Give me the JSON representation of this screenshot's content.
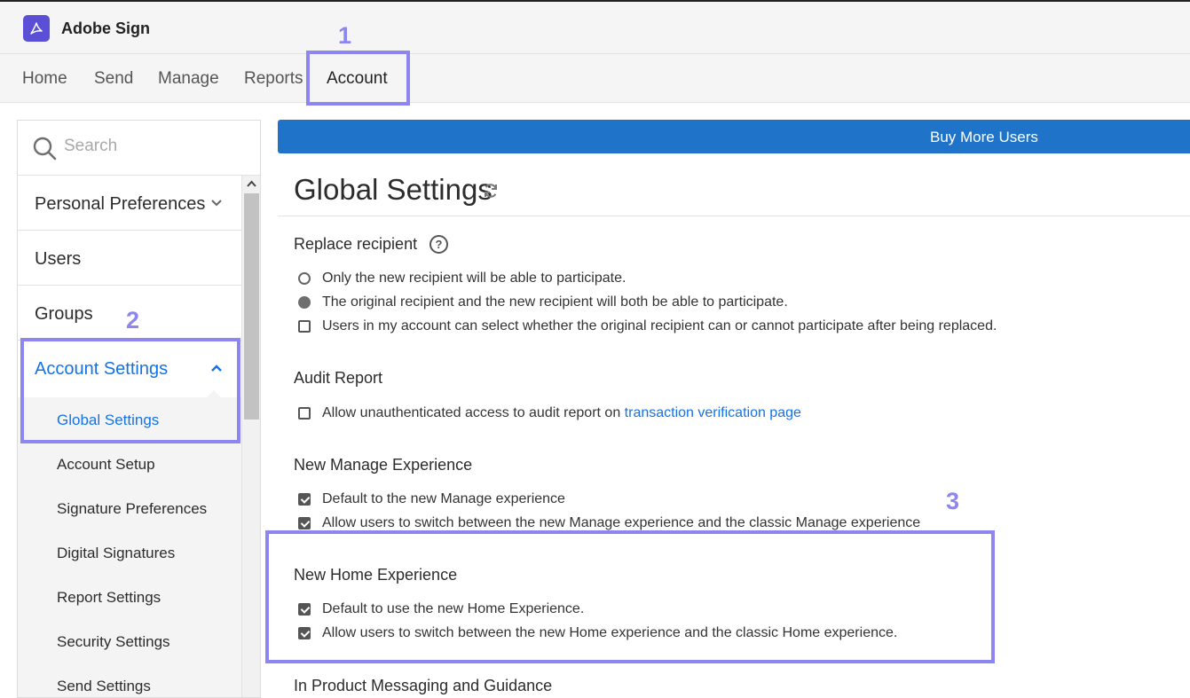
{
  "app": {
    "title": "Adobe Sign"
  },
  "nav": {
    "home": "Home",
    "send": "Send",
    "manage": "Manage",
    "reports": "Reports",
    "account": "Account"
  },
  "annotations": {
    "one": "1",
    "two": "2",
    "three": "3"
  },
  "search": {
    "placeholder": "Search"
  },
  "sidebar": {
    "items": [
      {
        "label": "Personal Preferences"
      },
      {
        "label": "Users"
      },
      {
        "label": "Groups"
      },
      {
        "label": "Account Settings"
      }
    ],
    "sub_items": [
      {
        "label": "Global Settings"
      },
      {
        "label": "Account Setup"
      },
      {
        "label": "Signature Preferences"
      },
      {
        "label": "Digital Signatures"
      },
      {
        "label": "Report Settings"
      },
      {
        "label": "Security Settings"
      },
      {
        "label": "Send Settings"
      }
    ]
  },
  "banner": {
    "button_label": "Buy More Users"
  },
  "main": {
    "title": "Global Settings",
    "sections": {
      "replace_recipient": {
        "title": "Replace recipient",
        "help": "?",
        "options": [
          "Only the new recipient will be able to participate.",
          "The original recipient and the new recipient will both be able to participate.",
          "Users in my account can select whether the original recipient can or cannot participate after being replaced."
        ]
      },
      "audit_report": {
        "title": "Audit Report",
        "option_prefix": "Allow unauthenticated access to audit report on",
        "option_link": "transaction verification page"
      },
      "new_manage": {
        "title": "New Manage Experience",
        "options": [
          "Default to the new Manage experience",
          "Allow users to switch between the new Manage experience and the classic Manage experience"
        ]
      },
      "new_home": {
        "title": "New Home Experience",
        "options": [
          "Default to use the new Home Experience.",
          "Allow users to switch between the new Home experience and the classic Home experience."
        ]
      },
      "in_product": {
        "title": "In Product Messaging and Guidance"
      }
    }
  },
  "state": {
    "replace_recipient_selected": 1,
    "replace_recipient_checkbox": false,
    "audit_checkbox": false,
    "manage_default": true,
    "manage_switch": true,
    "home_default": true,
    "home_switch": true
  },
  "colors": {
    "accent": "#1473e6",
    "banner": "#1f73c8",
    "annotation": "#8e86f0",
    "logo": "#5b4fd6"
  },
  "icons": {
    "logo": "adobe-acrobat-icon",
    "search": "search-icon",
    "refresh": "refresh-icon",
    "help": "help-icon",
    "chevron_down": "chevron-down-icon",
    "chevron_up": "chevron-up-icon"
  }
}
